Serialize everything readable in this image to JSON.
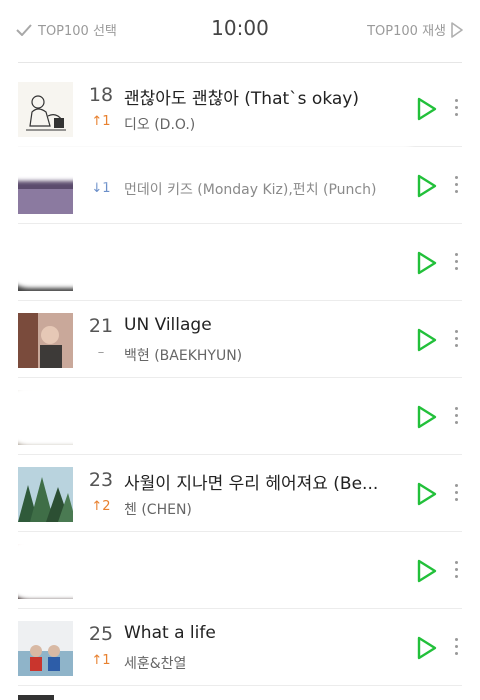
{
  "header": {
    "left_label": "TOP100 선택",
    "time": "10:00",
    "right_label": "TOP100 재생"
  },
  "rows": [
    {
      "rank": "18",
      "change": "↑1",
      "change_type": "up",
      "title": "괜찮아도 괜찮아 (That`s okay)",
      "artist": "디오 (D.O.)",
      "art": "sketch"
    },
    {
      "rank": "",
      "change": "↓1",
      "change_type": "down",
      "title": "",
      "artist": "먼데이 키즈 (Monday Kiz),펀치 (Punch)",
      "art": "purple"
    },
    {
      "rank": "",
      "change": "",
      "change_type": "same",
      "title": "",
      "artist": "",
      "art": "gray"
    },
    {
      "rank": "21",
      "change": "–",
      "change_type": "same",
      "title": "UN Village",
      "artist": "백현 (BAEKHYUN)",
      "art": "warm"
    },
    {
      "rank": "",
      "change": "",
      "change_type": "same",
      "title": "",
      "artist": "",
      "art": "beige"
    },
    {
      "rank": "23",
      "change": "↑2",
      "change_type": "up",
      "title": "사월이 지나면 우리 헤어져요 (Be...",
      "artist": "첸 (CHEN)",
      "art": "forest"
    },
    {
      "rank": "",
      "change": "",
      "change_type": "same",
      "title": "",
      "artist": "",
      "art": "dark"
    },
    {
      "rank": "25",
      "change": "↑1",
      "change_type": "up",
      "title": "What a life",
      "artist": "세훈&찬열",
      "art": "photo"
    }
  ],
  "icons": {
    "check": "check-icon",
    "play_all": "play-outline-icon",
    "row_play": "play-icon",
    "row_more": "more-vertical-icon"
  },
  "colors": {
    "play_green": "#22c03a",
    "rank_up": "#e8812f"
  }
}
